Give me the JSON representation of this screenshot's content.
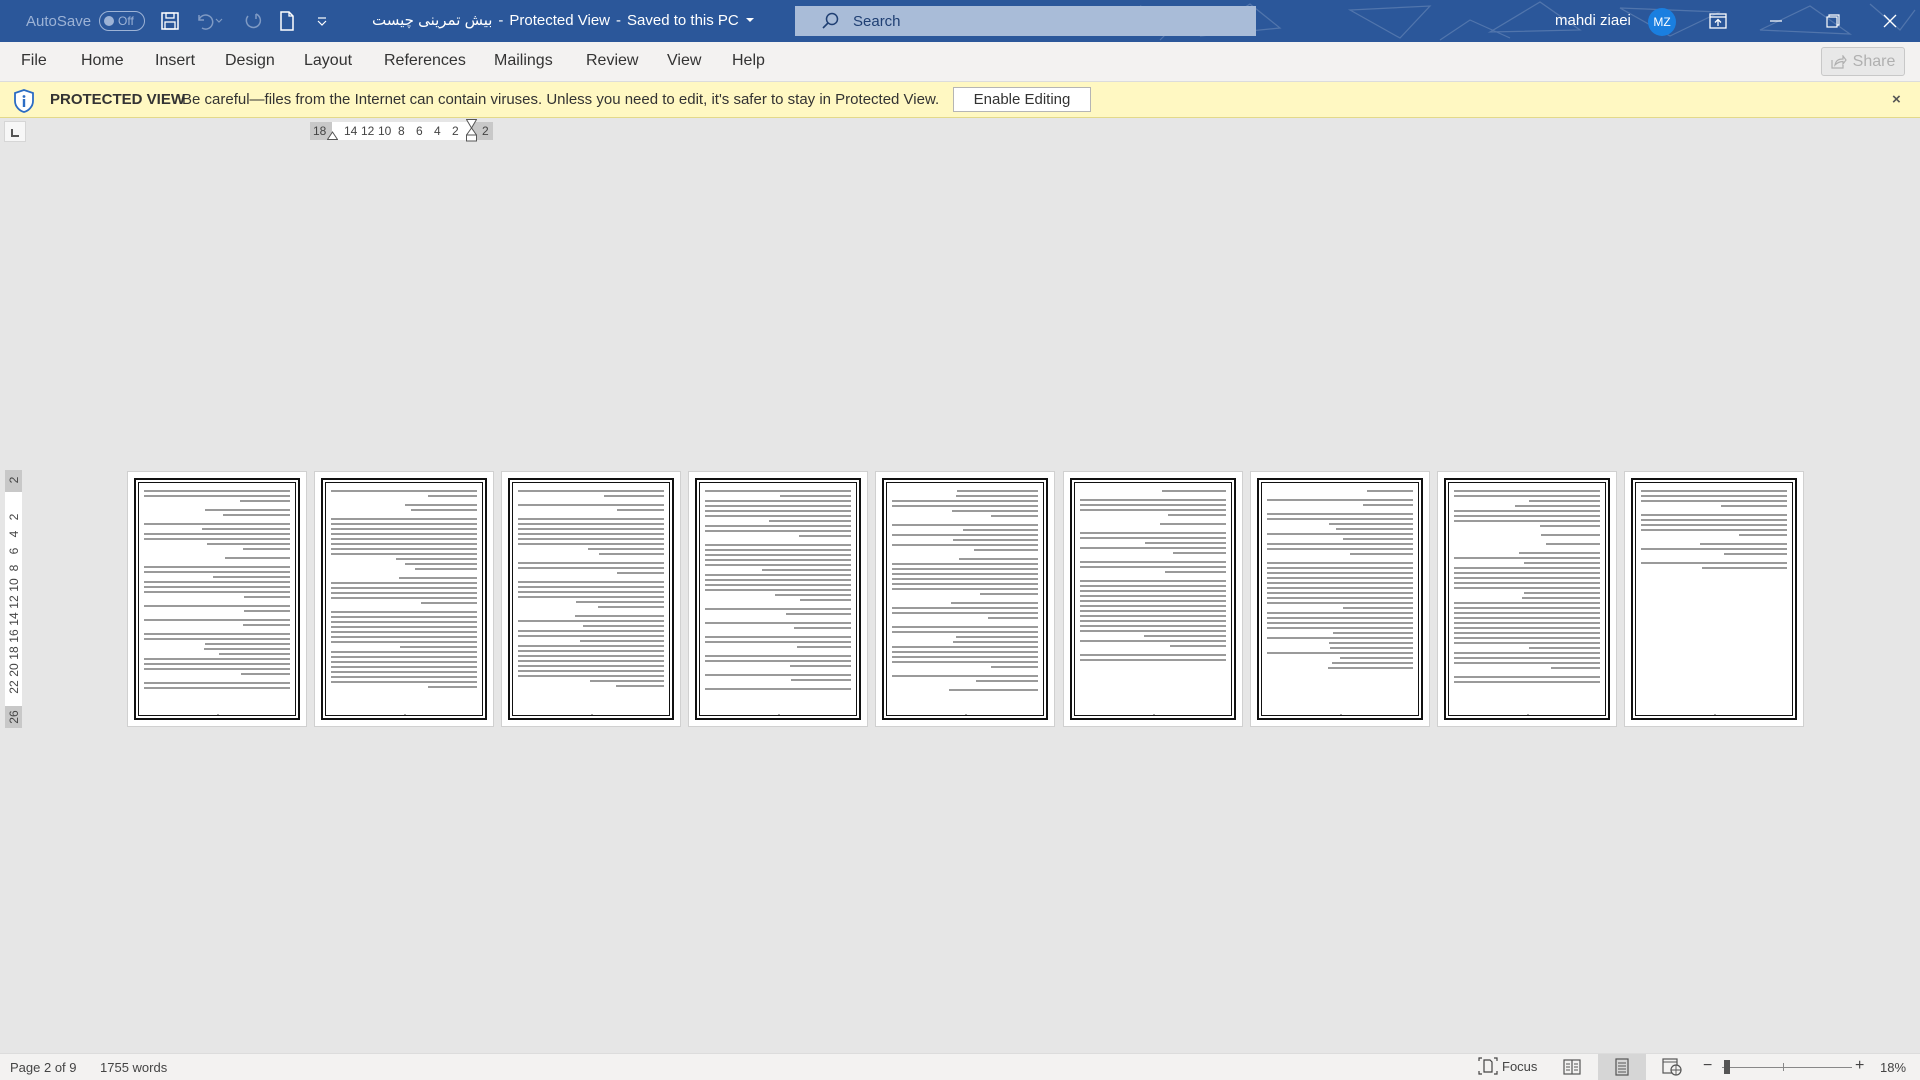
{
  "titlebar": {
    "autosave_label": "AutoSave",
    "autosave_state": "Off",
    "doc_name": "بیش تمرینی چیست",
    "separator": "-",
    "mode": "Protected View",
    "save_status": "Saved to this PC",
    "search_placeholder": "Search",
    "user_name": "mahdi ziaei",
    "user_initials": "MZ",
    "accent_color": "#2b579a"
  },
  "ribbon": {
    "tabs": [
      {
        "label": "File"
      },
      {
        "label": "Home"
      },
      {
        "label": "Insert"
      },
      {
        "label": "Design"
      },
      {
        "label": "Layout"
      },
      {
        "label": "References"
      },
      {
        "label": "Mailings"
      },
      {
        "label": "Review"
      },
      {
        "label": "View"
      },
      {
        "label": "Help"
      }
    ],
    "share_label": "Share"
  },
  "protected_view": {
    "label": "PROTECTED VIEW",
    "message": "Be careful—files from the Internet can contain viruses. Unless you need to edit, it's safer to stay in Protected View.",
    "enable_button": "Enable Editing",
    "close_glyph": "×",
    "bar_color": "#fff8c2"
  },
  "rulers": {
    "horizontal_ticks": [
      "18",
      "14",
      "12",
      "10",
      "8",
      "6",
      "4",
      "2",
      "2"
    ],
    "vertical_ticks": [
      "2",
      "2",
      "4",
      "6",
      "8",
      "10",
      "12",
      "14",
      "16",
      "18",
      "20",
      "22",
      "26"
    ]
  },
  "document": {
    "pages": [
      {
        "number": 1
      },
      {
        "number": 2
      },
      {
        "number": 3
      },
      {
        "number": 4
      },
      {
        "number": 5
      },
      {
        "number": 6
      },
      {
        "number": 7
      },
      {
        "number": 8
      },
      {
        "number": 9
      }
    ]
  },
  "statusbar": {
    "page_info": "Page 2 of 9",
    "word_count": "1755 words",
    "focus_label": "Focus",
    "zoom_minus": "−",
    "zoom_plus": "+",
    "zoom_percent": "18%",
    "zoom_value": 18
  }
}
